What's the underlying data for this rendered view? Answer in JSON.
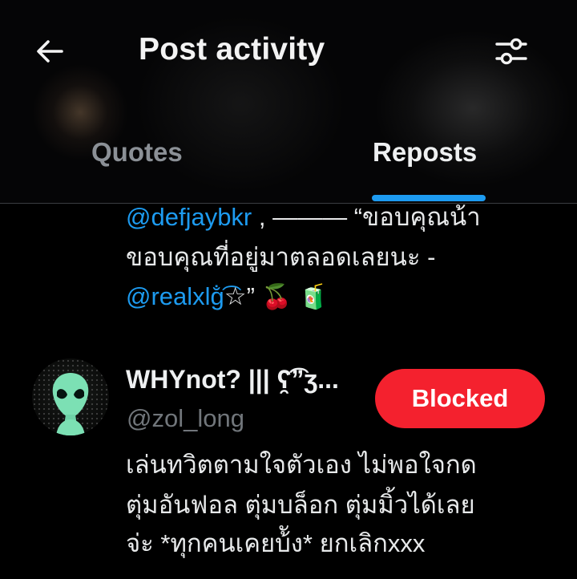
{
  "header": {
    "title": "Post activity",
    "back_icon": "arrow-left-icon",
    "filter_icon": "sliders-icon"
  },
  "tabs": [
    {
      "label": "Quotes",
      "active": false
    },
    {
      "label": "Reposts",
      "active": true
    }
  ],
  "colors": {
    "accent": "#1d9bf0",
    "blocked": "#f4212e",
    "background": "#000000",
    "secondary_text": "#71767b"
  },
  "previous_post": {
    "mention_1": "@defjaybkr",
    "line1_text": " , ——— “ขอบคุณน้า",
    "line2_text": "ขอบคุณที่อยู่มาตลอดเลยนะ -",
    "mention_2": "@realxlg",
    "line3_suffix": "̐͡☆”",
    "emoji_1": "🍒",
    "emoji_2": "🧃"
  },
  "user": {
    "display_name": "WHYnot? ||| ʕ̯͡”ʒ...",
    "handle": "@zol_long",
    "avatar_icon": "alien-icon",
    "action_button": "Blocked",
    "bio_lines": [
      "เล่นทวิตตามใจตัวเอง ไม่พอใจกด",
      "ตุ่มอันฟอล ตุ่มบล็อก ตุ่มมิ้วได้เลย",
      "จ่ะ *ทุกคนเคยบ้ัง* ยกเลิกxxx"
    ]
  }
}
